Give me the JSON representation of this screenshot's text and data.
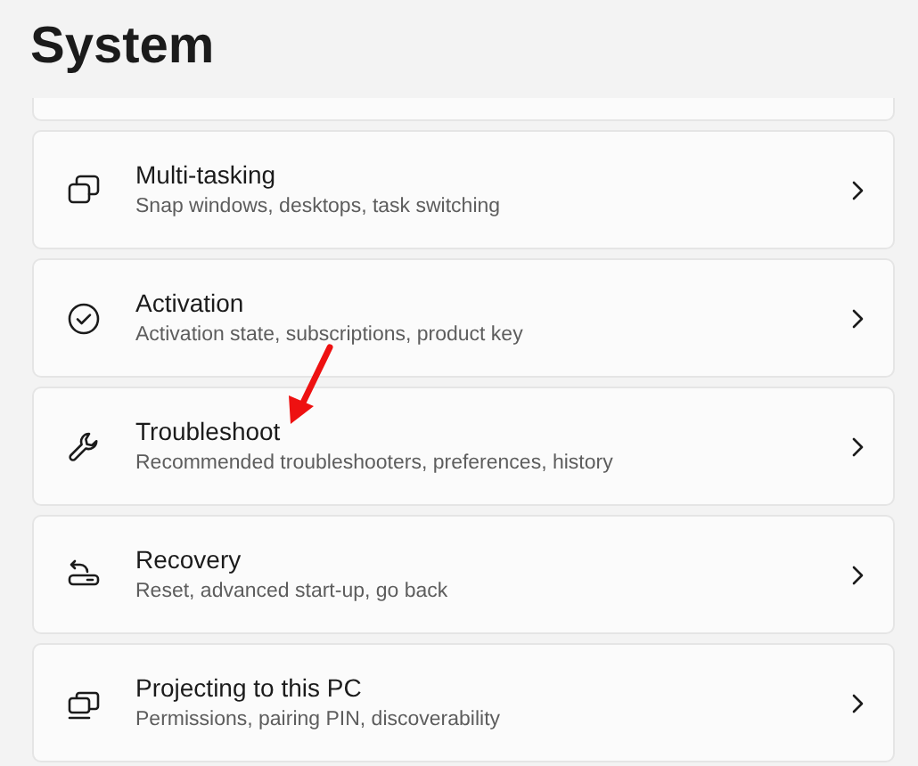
{
  "title": "System",
  "items": [
    {
      "kind": "multitasking",
      "title": "Multi-tasking",
      "subtitle": "Snap windows, desktops, task switching"
    },
    {
      "kind": "activation",
      "title": "Activation",
      "subtitle": "Activation state, subscriptions, product key"
    },
    {
      "kind": "troubleshoot",
      "title": "Troubleshoot",
      "subtitle": "Recommended troubleshooters, preferences, history"
    },
    {
      "kind": "recovery",
      "title": "Recovery",
      "subtitle": "Reset, advanced start-up, go back"
    },
    {
      "kind": "projecting",
      "title": "Projecting to this PC",
      "subtitle": "Permissions, pairing PIN, discoverability"
    }
  ]
}
